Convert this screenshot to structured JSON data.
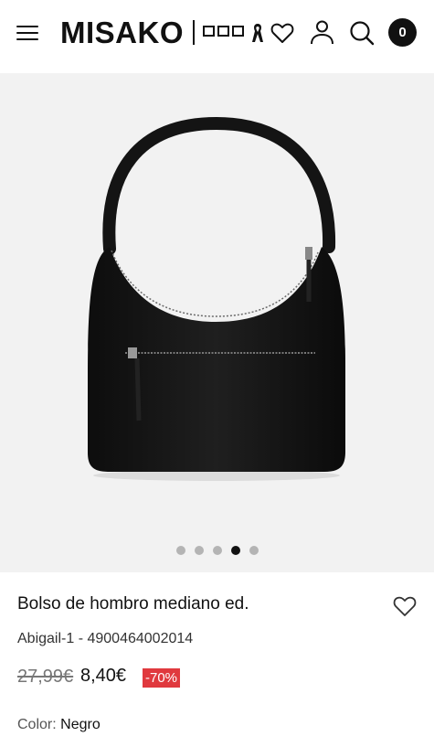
{
  "header": {
    "logo": "MISAKO",
    "cart_count": "0",
    "icons": [
      "menu-icon",
      "awareness-ribbon-icon",
      "heart-icon",
      "user-icon",
      "search-icon",
      "cart-icon"
    ]
  },
  "gallery": {
    "image": "black-shoulder-bag",
    "dot_count": 5,
    "active_index": 3
  },
  "product": {
    "title": "Bolso de hombro mediano ed.",
    "reference": "Abigail-1 - 4900464002014",
    "old_price": "27,99€",
    "price": "8,40€",
    "discount": "-70%",
    "color_label": "Color:",
    "color_value": "Negro"
  },
  "colors": {
    "accent": "#111111",
    "discount_badge": "#e0393e",
    "gallery_bg": "#f2f2f2"
  }
}
